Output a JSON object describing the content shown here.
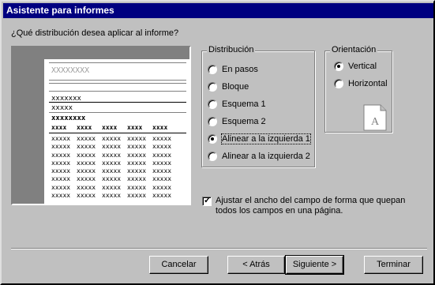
{
  "window": {
    "title": "Asistente para informes"
  },
  "question": "¿Qué distribución desea aplicar al informe?",
  "preview": {
    "title_placeholder": "XXXXXXXX",
    "group_lines": [
      "xxxxxxx",
      "xxxxx",
      "xxxxxxxx"
    ],
    "header_cells": [
      "xxxx",
      "xxxx",
      "xxxx",
      "xxxx",
      "xxxx"
    ],
    "detail_cell": "xxxxx"
  },
  "layout_group": {
    "title": "Distribución",
    "options": [
      {
        "label": "En pasos",
        "selected": false
      },
      {
        "label": "Bloque",
        "selected": false
      },
      {
        "label": "Esquema 1",
        "selected": false
      },
      {
        "label": "Esquema 2",
        "selected": false
      },
      {
        "label": "Alinear a la izquierda 1",
        "selected": true
      },
      {
        "label": "Alinear a la izquierda 2",
        "selected": false
      }
    ]
  },
  "orientation_group": {
    "title": "Orientación",
    "options": [
      {
        "label": "Vertical",
        "selected": true
      },
      {
        "label": "Horizontal",
        "selected": false
      }
    ],
    "icon_letter": "A"
  },
  "adjust_checkbox": {
    "checked": true,
    "label": "Ajustar el ancho del campo de forma que quepan todos los campos en una página."
  },
  "buttons": {
    "cancel": "Cancelar",
    "back": "< Atrás",
    "next": "Siguiente >",
    "finish": "Terminar"
  }
}
